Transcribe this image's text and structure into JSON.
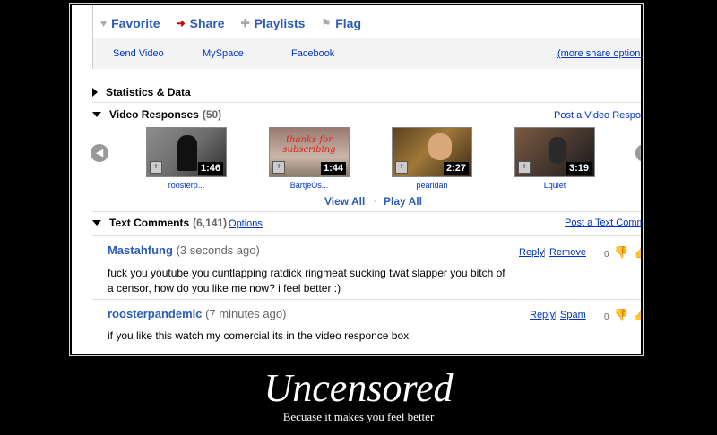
{
  "tabs": [
    {
      "label": "Favorite",
      "icon": "heart-icon"
    },
    {
      "label": "Share",
      "icon": "arrow-right-icon"
    },
    {
      "label": "Playlists",
      "icon": "plus-icon"
    },
    {
      "label": "Flag",
      "icon": "flag-icon"
    }
  ],
  "share": {
    "send_video": "Send Video",
    "myspace": "MySpace",
    "facebook": "Facebook",
    "more": "(more share options"
  },
  "statistics": {
    "label": "Statistics & Data"
  },
  "responses": {
    "label": "Video Responses",
    "count": "(50)",
    "post_link": "Post a Video Respon",
    "view_all": "View All",
    "separator": "-",
    "play_all": "Play All",
    "videos": [
      {
        "duration": "1:46",
        "label": "roosterp..."
      },
      {
        "duration": "1:44",
        "label": "BartjeOs...",
        "overlay": "thanks for subscribing"
      },
      {
        "duration": "2:27",
        "label": "pearldan"
      },
      {
        "duration": "3:19",
        "label": "Lquiet"
      }
    ]
  },
  "comments": {
    "label": "Text Comments",
    "count": "(6,141)",
    "options": "Options",
    "post_link": "Post a Text Comm",
    "items": [
      {
        "author": "Mastahfung",
        "time": "(3 seconds ago)",
        "actions": [
          "Reply",
          "Remove"
        ],
        "score": "0",
        "text": "fuck you youtube you cuntlapping ratdick ringmeat sucking twat slapper you bitch of a censor, how do you like me now? i feel better :)"
      },
      {
        "author": "roosterpandemic",
        "time": "(7 minutes ago)",
        "actions": [
          "Reply",
          "Spam"
        ],
        "score": "0",
        "text": "if you like this watch my comercial its in the video responce box"
      }
    ]
  },
  "caption": {
    "title": "Uncensored",
    "subtitle": "Becuase it makes you feel better"
  },
  "colors": {
    "link": "#2b5cb8",
    "share_icon": "#cc0000"
  }
}
